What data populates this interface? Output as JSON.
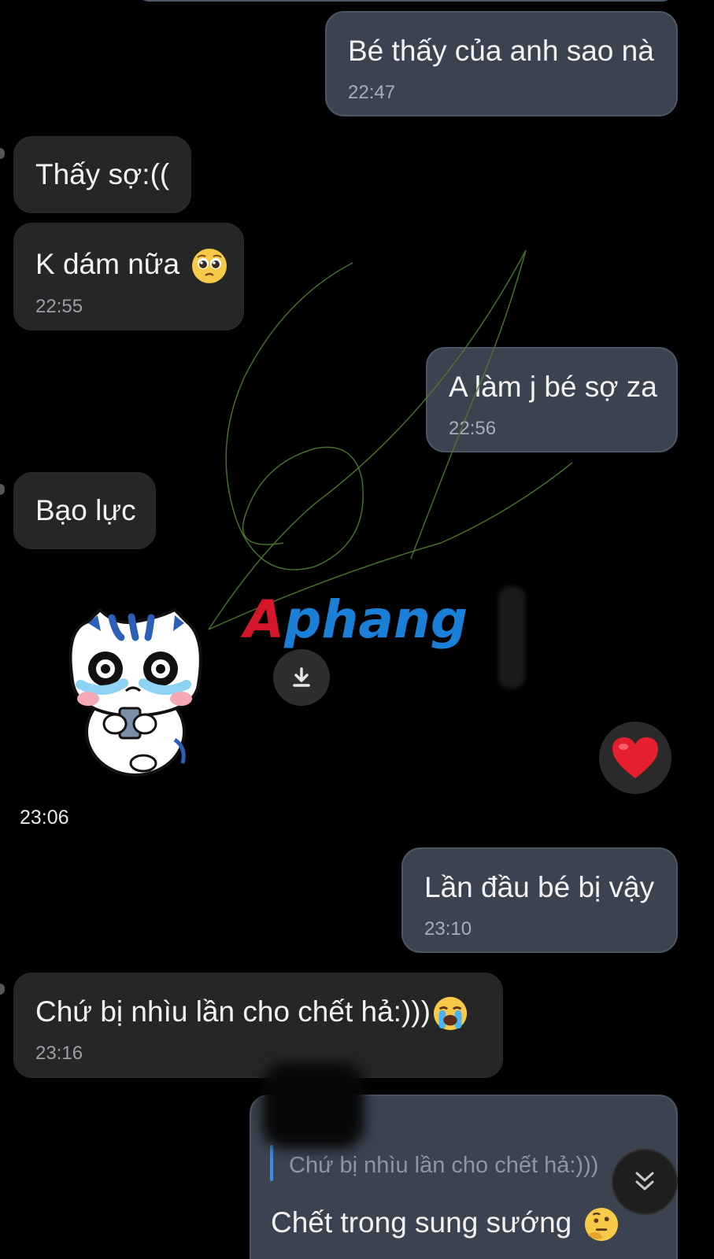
{
  "messages": [
    {
      "side": "out",
      "text": "Bé thấy của anh sao nà",
      "time": "22:47"
    },
    {
      "side": "in",
      "text": "Thấy sợ:(("
    },
    {
      "side": "in",
      "text": "K dám nữa",
      "emoji": "pleading-face",
      "time": "22:55"
    },
    {
      "side": "out",
      "text": "A làm j bé sợ za",
      "time": "22:56"
    },
    {
      "side": "in",
      "text": "Bạo lực"
    },
    {
      "side": "in",
      "sticker": "crying-cat-holding-phone",
      "time": "23:06",
      "reaction": "red-heart"
    },
    {
      "side": "out",
      "text": "Lần đầu bé bị vậy",
      "time": "23:10"
    },
    {
      "side": "in",
      "text": "Chứ bị nhìu lần cho chết hả:)))",
      "emoji": "loudly-crying-face",
      "time": "23:16"
    },
    {
      "side": "out",
      "quote": "Chứ bị nhìu lần cho chết hả:)))",
      "text": "Chết trong sung sướng",
      "emoji": "thinking-face"
    }
  ],
  "watermark": {
    "text": "Aphang"
  },
  "icons": {
    "download": "download-icon",
    "scroll_down": "double-chevron-down-icon",
    "reaction": "red-heart"
  },
  "colors": {
    "background": "#000000",
    "incoming": "#262626",
    "outgoing": "#3b4350",
    "heart": "#e5202e",
    "watermark_red": "#d6172a",
    "watermark_blue": "#1a7fd6"
  }
}
